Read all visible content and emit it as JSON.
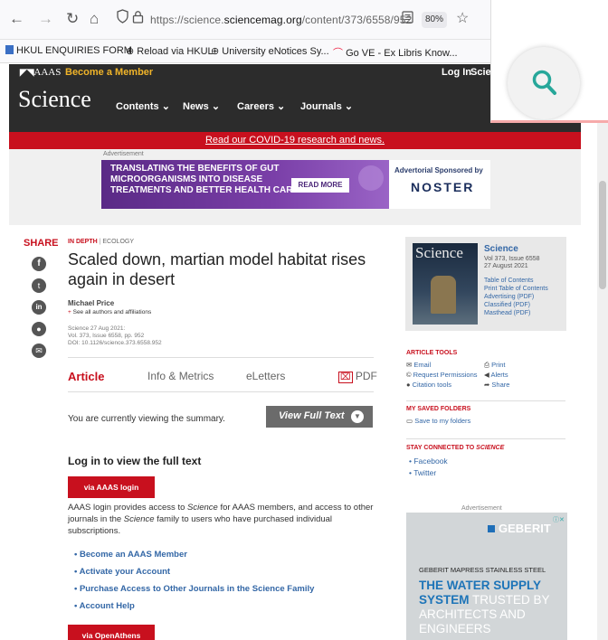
{
  "browser": {
    "url_prefix": "https://science.",
    "url_domain": "sciencemag.org",
    "url_path": "/content/373/6558/952",
    "zoom": "80%",
    "bookmarks": [
      "HKUL ENQUIRIES FORM",
      "Reload via HKUL",
      "University eNotices Sy...",
      "Go VE - Ex Libris Know..."
    ]
  },
  "site": {
    "aaas_logo": "AAAS",
    "become_member": "Become a Member",
    "login": "Log In",
    "login_trunc": "Scien",
    "logo": "Science",
    "nav": [
      "Contents",
      "News",
      "Careers",
      "Journals"
    ],
    "covid": "Read our COVID-19 research and news.",
    "ad_label": "Advertisement",
    "ad_text_1": "TRANSLATING THE BENEFITS OF GUT",
    "ad_text_2": "MICROORGANISMS INTO DISEASE",
    "ad_text_3": "TREATMENTS AND BETTER HEALTH CARE",
    "ad_button": "READ MORE",
    "ad_sponsor": "Advertorial Sponsored by",
    "ad_brand": "NOSTER"
  },
  "article": {
    "share": "SHARE",
    "section": "IN DEPTH",
    "category": "ECOLOGY",
    "title_1": "Scaled down, martian model habitat rises",
    "title_2": "again in desert",
    "author": "Michael Price",
    "affil_link": "See all authors and affiliations",
    "cite_1": "Science  27 Aug 2021:",
    "cite_2": "Vol. 373, Issue 6558, pp. 952",
    "cite_3": "DOI: 10.1126/science.373.6558.952",
    "tabs": [
      "Article",
      "Info & Metrics",
      "eLetters",
      "PDF"
    ],
    "summary_note": "You are currently viewing the summary.",
    "view_full": "View Full Text",
    "login_heading": "Log in to view the full text",
    "aaas_login_btn": "via AAAS login",
    "login_desc_1": "AAAS login provides access to ",
    "login_desc_em": "Science",
    "login_desc_2": " for AAAS members, and access to other",
    "login_desc_3": "journals in the ",
    "login_desc_4": " family to users who have purchased individual",
    "login_desc_5": "subscriptions.",
    "options": [
      "Become an AAAS Member",
      "Activate your Account",
      "Purchase Access to Other Journals in the Science Family",
      "Account Help"
    ],
    "openathens_btn": "via OpenAthens"
  },
  "sidebar": {
    "journal": "Science",
    "vol": "Vol 373, Issue 6558",
    "date": "27 August 2021",
    "links": [
      "Table of Contents",
      "Print Table of Contents",
      "Advertising (PDF)",
      "Classified (PDF)",
      "Masthead (PDF)"
    ],
    "cover_text": "Science",
    "tools_heading": "ARTICLE TOOLS",
    "tools": [
      "Email",
      "Print",
      "Request Permissions",
      "Alerts",
      "Citation tools",
      "Share"
    ],
    "folders_heading": "MY SAVED FOLDERS",
    "folders_link": "Save to my folders",
    "connected_heading": "STAY CONNECTED TO ",
    "connected_em": "SCIENCE",
    "social": [
      "Facebook",
      "Twitter"
    ],
    "ad_label": "Advertisement",
    "geberit_brand": "GEBERIT",
    "geberit_line": "GEBERIT MAPRESS STAINLESS STEEL",
    "geberit_big_1": "THE WATER SUPPLY",
    "geberit_big_2": "SYSTEM",
    "geberit_big_3": " TRUSTED BY",
    "geberit_big_4": "ARCHITECTS AND",
    "geberit_big_5": "ENGINEERS"
  },
  "colors": {
    "science_red": "#c8101e",
    "dark": "#2c2c2c",
    "link": "#3367a6",
    "magnifier_green": "#27a79a"
  }
}
